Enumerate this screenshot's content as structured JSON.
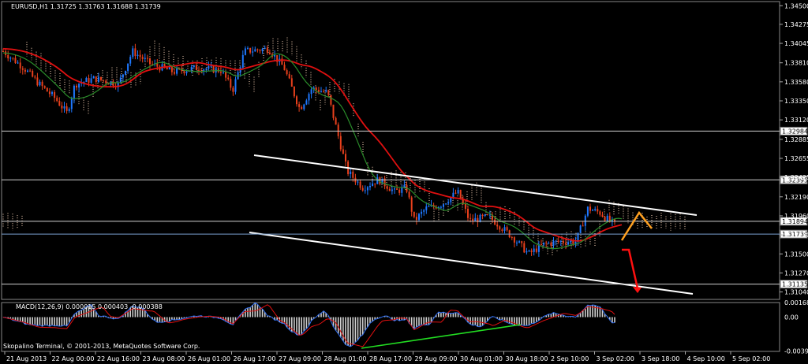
{
  "chart_data": {
    "type": "candlestick",
    "title": "EURUSD,H1  1.31725 1.31763 1.31688 1.31739",
    "symbol": "EURUSD",
    "timeframe": "H1",
    "ohlc": {
      "open": 1.31725,
      "high": 1.31763,
      "low": 1.31688,
      "close": 1.31739
    },
    "ylim": [
      1.31,
      1.345
    ],
    "price_ticks": [
      "1.34500",
      "1.34275",
      "1.34045",
      "1.33810",
      "1.33580",
      "1.33350",
      "1.33120",
      "1.32885",
      "1.32655",
      "1.32425",
      "1.32190",
      "1.31960",
      "1.31730",
      "1.31500",
      "1.31270",
      "1.31040"
    ],
    "horizontal_levels": [
      "1.32984",
      "1.32395",
      "1.31894",
      "1.31739",
      "1.31135"
    ],
    "current_price": "1.31739",
    "x_ticks": [
      "21 Aug 2013",
      "22 Aug 00:00",
      "22 Aug 16:00",
      "23 Aug 08:00",
      "26 Aug 01:00",
      "26 Aug 17:00",
      "27 Aug 09:00",
      "28 Aug 01:00",
      "28 Aug 17:00",
      "29 Aug 09:00",
      "30 Aug 01:00",
      "30 Aug 18:00",
      "2 Sep 10:00",
      "3 Sep 02:00",
      "3 Sep 18:00",
      "4 Sep 10:00",
      "5 Sep 02:00"
    ],
    "indicator": {
      "label": "MACD(12,26,9) 0.000015 0.000403 -0.000388",
      "name": "MACD(12,26,9)",
      "values": [
        1.5e-05,
        0.000403,
        -0.000388
      ],
      "ticks": [
        "0.001682",
        "0.00",
        "-0.003957"
      ]
    },
    "copyright": "Skopalino Terminal, © 2001-2013, MetaQuotes Software Corp.",
    "colors": {
      "background": "#000000",
      "bull": "#1e78ff",
      "bear": "#e8401c",
      "ma_red": "#e01010",
      "ma_green": "#2a8c2a",
      "channel": "#ffffff",
      "cloud": "#d8b8a0",
      "arrow_orange": "#ffa020",
      "arrow_red": "#ff1010"
    }
  }
}
